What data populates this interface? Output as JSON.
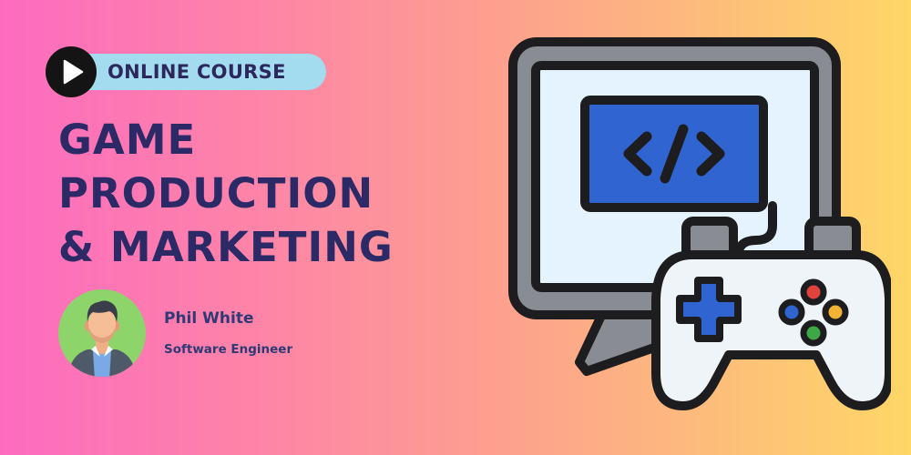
{
  "badge": {
    "label": "ONLINE COURSE",
    "icon": "play-icon"
  },
  "course_title": {
    "lines": [
      "GAME",
      "PRODUCTION",
      "& MARKETING"
    ]
  },
  "author": {
    "name": "Phil White",
    "role": "Software Engineer",
    "avatar_icon": "person-avatar"
  },
  "illustration": {
    "monitor_icon": "monitor-code-icon",
    "code_glyph": "</>",
    "controller_icon": "gamepad-icon"
  },
  "colors": {
    "gradient_left": "#fd6bbf",
    "gradient_right": "#fed767",
    "title_text": "#2b2a66",
    "badge_fill": "#a4dcef",
    "screen_blue": "#3064d0",
    "outline": "#1d1d1f"
  }
}
